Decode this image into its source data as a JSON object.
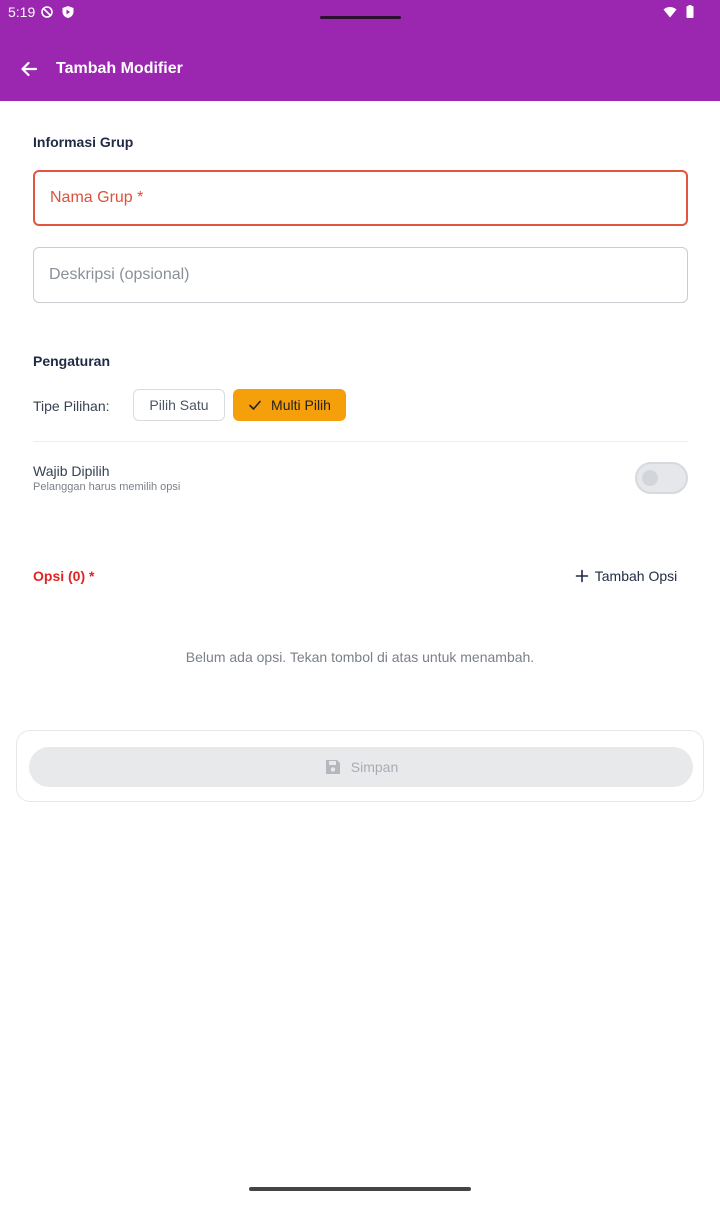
{
  "status_bar": {
    "time": "5:19"
  },
  "app_bar": {
    "title": "Tambah Modifier"
  },
  "group_info": {
    "section_title": "Informasi Grup",
    "name_field": {
      "placeholder": "Nama Grup *",
      "value": ""
    },
    "description_field": {
      "placeholder": "Deskripsi (opsional)",
      "value": ""
    }
  },
  "settings": {
    "section_title": "Pengaturan",
    "selection_type": {
      "label": "Tipe Pilihan:",
      "options": [
        "Pilih Satu",
        "Multi Pilih"
      ],
      "selected": "Multi Pilih"
    },
    "required": {
      "label": "Wajib Dipilih",
      "description": "Pelanggan harus memilih opsi",
      "enabled": false
    }
  },
  "options": {
    "title": "Opsi (0) *",
    "add_label": "Tambah Opsi",
    "empty_message": "Belum ada opsi. Tekan tombol di atas untuk menambah."
  },
  "save": {
    "label": "Simpan"
  },
  "colors": {
    "app_bar": "#9b27b0",
    "accent": "#f59f0a",
    "error": "#e02424",
    "field_error_border": "#e2553f"
  }
}
